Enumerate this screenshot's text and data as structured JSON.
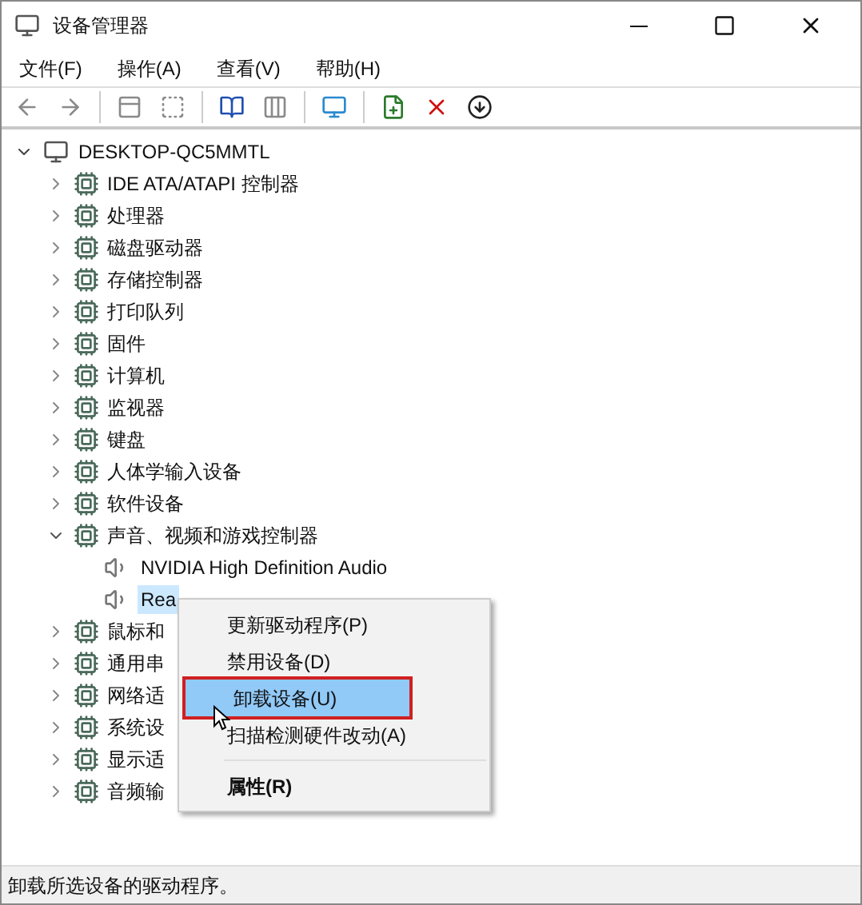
{
  "window": {
    "title": "设备管理器"
  },
  "menu": [
    "文件(F)",
    "操作(A)",
    "查看(V)",
    "帮助(H)"
  ],
  "tree": {
    "root": {
      "label": "DESKTOP-QC5MMTL",
      "expanded": true
    },
    "categories": [
      {
        "label": "IDE ATA/ATAPI 控制器",
        "expanded": false
      },
      {
        "label": "处理器",
        "expanded": false
      },
      {
        "label": "磁盘驱动器",
        "expanded": false
      },
      {
        "label": "存储控制器",
        "expanded": false
      },
      {
        "label": "打印队列",
        "expanded": false
      },
      {
        "label": "固件",
        "expanded": false
      },
      {
        "label": "计算机",
        "expanded": false
      },
      {
        "label": "监视器",
        "expanded": false
      },
      {
        "label": "键盘",
        "expanded": false
      },
      {
        "label": "人体学输入设备",
        "expanded": false
      },
      {
        "label": "软件设备",
        "expanded": false
      },
      {
        "label": "声音、视频和游戏控制器",
        "expanded": true,
        "children": [
          {
            "label": "NVIDIA High Definition Audio",
            "selected": false
          },
          {
            "label": "Rea",
            "selected": true
          }
        ]
      },
      {
        "label": "鼠标和",
        "expanded": false
      },
      {
        "label": "通用串",
        "expanded": false
      },
      {
        "label": "网络适",
        "expanded": false
      },
      {
        "label": "系统设",
        "expanded": false
      },
      {
        "label": "显示适",
        "expanded": false
      },
      {
        "label": "音频输",
        "expanded": false
      }
    ]
  },
  "context_menu": [
    {
      "kind": "item",
      "label": "更新驱动程序(P)",
      "selected": false,
      "bold": false
    },
    {
      "kind": "item",
      "label": "禁用设备(D)",
      "selected": false,
      "bold": false
    },
    {
      "kind": "item",
      "label": "卸载设备(U)",
      "selected": true,
      "bold": false
    },
    {
      "kind": "item",
      "label": "扫描检测硬件改动(A)",
      "selected": false,
      "bold": false
    },
    {
      "kind": "separator"
    },
    {
      "kind": "item",
      "label": "属性(R)",
      "selected": false,
      "bold": true
    }
  ],
  "status_bar": "卸载所选设备的驱动程序。"
}
